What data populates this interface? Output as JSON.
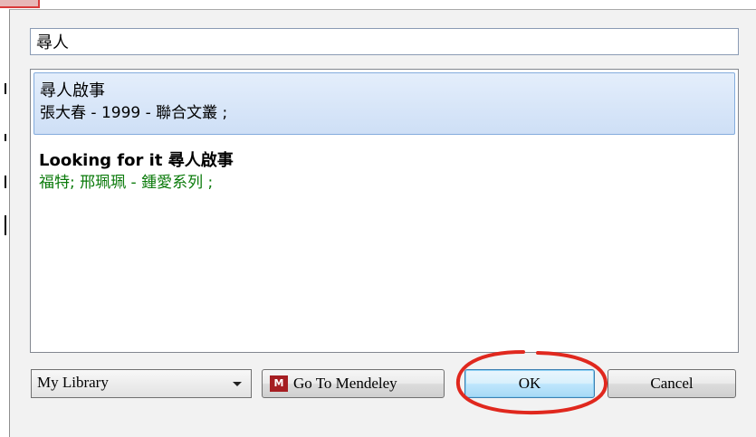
{
  "search": {
    "value": "尋人"
  },
  "results": [
    {
      "title": "尋人啟事",
      "subtitle": "張大春 - 1999 - 聯合文叢 ;",
      "subtitle_color": "#000000",
      "selected": true
    },
    {
      "title": "Looking for it 尋人啟事",
      "subtitle": "福特; 邢珮珮 - 鍾愛系列 ;",
      "subtitle_color": "#0a7a0a",
      "selected": false
    }
  ],
  "footer": {
    "library_select": {
      "selected": "My Library"
    },
    "mendeley_button": {
      "label": "Go To Mendeley",
      "icon": "mendeley-icon"
    },
    "ok_button": {
      "label": "OK"
    },
    "cancel_button": {
      "label": "Cancel"
    }
  },
  "colors": {
    "selection_highlight": "#cedff6",
    "annotation_circle": "#e0281e",
    "mendeley_brand": "#a51e22"
  }
}
